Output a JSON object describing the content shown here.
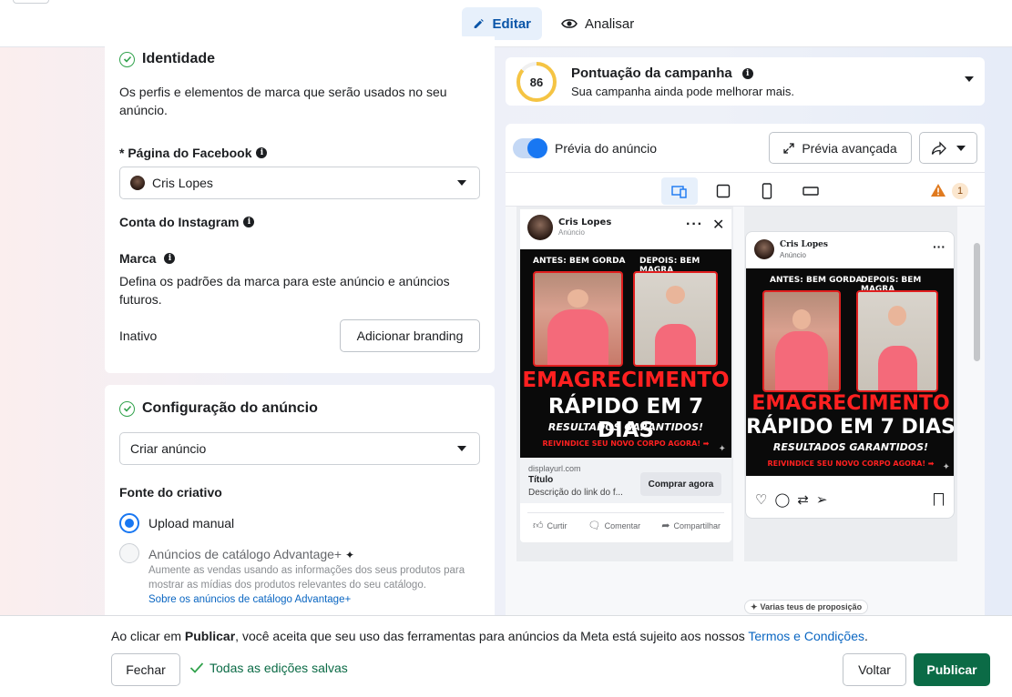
{
  "tabs": {
    "edit": "Editar",
    "analyze": "Analisar"
  },
  "identity": {
    "title": "Identidade",
    "description": "Os perfis e elementos de marca que serão usados no seu anúncio.",
    "facebook_label": "* Página do Facebook",
    "facebook_page": "Cris Lopes",
    "instagram_label": "Conta do Instagram",
    "brand_label": "Marca",
    "brand_description": "Defina os padrões da marca para este anúncio e anúncios futuros.",
    "brand_status": "Inativo",
    "add_branding": "Adicionar branding"
  },
  "ad_config": {
    "title": "Configuração do anúncio",
    "select_value": "Criar anúncio",
    "source_label": "Fonte do criativo",
    "option_manual": "Upload manual",
    "option_catalog": "Anúncios de catálogo Advantage+",
    "catalog_description": "Aumente as vendas usando as informações dos seus produtos para mostrar as mídias dos produtos relevantes do seu catálogo.",
    "catalog_link": "Sobre os anúncios de catálogo Advantage+"
  },
  "score": {
    "value": "86",
    "title": "Pontuação da campanha",
    "subtitle": "Sua campanha ainda pode melhorar mais."
  },
  "preview": {
    "toggle_label": "Prévia do anúncio",
    "advanced": "Prévia avançada",
    "warning_count": "1",
    "more_hint": "Varias teus de proposição"
  },
  "ad": {
    "page_name": "Cris Lopes",
    "sponsored": "Anúncio",
    "before": "ANTES: BEM GORDA",
    "after": "DEPOIS: BEM MAGRA",
    "headline1": "EMAGRECIMENTO",
    "headline2": "RÁPIDO EM 7 DIAS",
    "headline3": "RESULTADOS GARANTIDOS!",
    "headline4": "REIVINDICE SEU NOVO CORPO AGORA! ➡",
    "url": "displayurl.com",
    "link_title": "Título",
    "link_desc": "Descrição do link do f...",
    "cta": "Comprar agora",
    "like": "Curtir",
    "comment": "Comentar",
    "share": "Compartilhar"
  },
  "footer": {
    "text_prefix": "Ao clicar em ",
    "text_bold": "Publicar",
    "text_middle": ", você aceita que seu uso das ferramentas para anúncios da Meta está sujeito aos nossos ",
    "terms": "Termos e Condições",
    "text_end": ".",
    "close": "Fechar",
    "saved": "Todas as edições salvas",
    "back": "Voltar",
    "publish": "Publicar"
  },
  "colors": {
    "accent": "#1877f2",
    "publish": "#0b6b46",
    "score_ring": "#f5c443",
    "warning": "#e07a1f"
  }
}
